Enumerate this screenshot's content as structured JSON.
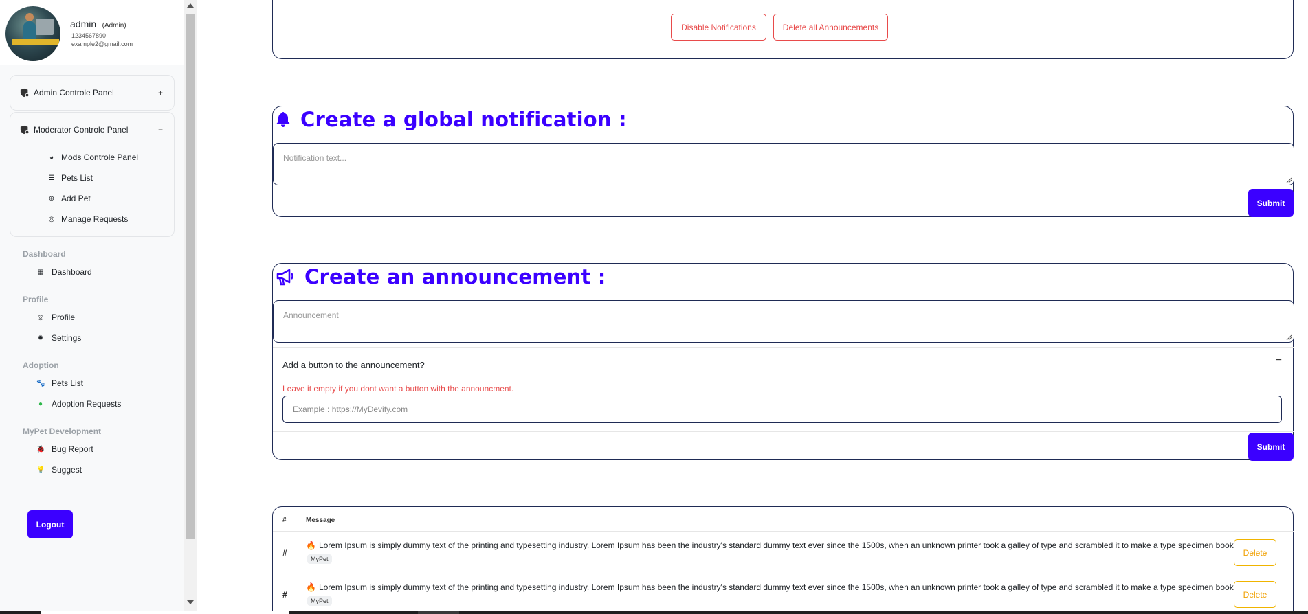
{
  "profile": {
    "name": "admin",
    "role": "(Admin)",
    "phone": "1234567890",
    "email": "example2@gmail.com"
  },
  "sidebar": {
    "admin_panel": {
      "label": "Admin Controle Panel",
      "toggle": "+"
    },
    "moderator_panel": {
      "label": "Moderator Controle Panel",
      "toggle": "−",
      "items": [
        {
          "label": "Mods Controle Panel",
          "icon": "palette-icon"
        },
        {
          "label": "Pets List",
          "icon": "list-icon"
        },
        {
          "label": "Add Pet",
          "icon": "plus-circle-icon"
        },
        {
          "label": "Manage Requests",
          "icon": "user-circle-icon"
        }
      ]
    },
    "sections": [
      {
        "title": "Dashboard",
        "items": [
          {
            "label": "Dashboard",
            "icon": "dashboard-icon"
          }
        ]
      },
      {
        "title": "Profile",
        "items": [
          {
            "label": "Profile",
            "icon": "user-circle-icon"
          },
          {
            "label": "Settings",
            "icon": "gear-icon"
          }
        ]
      },
      {
        "title": "Adoption",
        "items": [
          {
            "label": "Pets List",
            "icon": "paw-icon"
          },
          {
            "label": "Adoption Requests",
            "icon": "check-circle-icon"
          }
        ]
      },
      {
        "title": "MyPet Development",
        "items": [
          {
            "label": "Bug Report",
            "icon": "bug-icon"
          },
          {
            "label": "Suggest",
            "icon": "lightbulb-icon"
          }
        ]
      }
    ],
    "logout_label": "Logout"
  },
  "top_card": {
    "disable_label": "Disable Notifications",
    "delete_all_label": "Delete all Announcements"
  },
  "notification": {
    "title": "Create a global notification :",
    "placeholder": "Notification text...",
    "submit_label": "Submit"
  },
  "announcement": {
    "title": "Create an announcement :",
    "placeholder": "Announcement",
    "button_question": "Add a button to the announcement?",
    "toggle": "−",
    "warning": "Leave it empty if you dont want a button with the announcment.",
    "url_placeholder": "Example : https://MyDevify.com",
    "submit_label": "Submit"
  },
  "table": {
    "col_hash": "#",
    "col_message": "Message",
    "rows": [
      {
        "hash": "#",
        "message": "Lorem Ipsum is simply dummy text of the printing and typesetting industry. Lorem Ipsum has been the industry's standard dummy text ever since the 1500s, when an unknown printer took a galley of type and scrambled it to make a type specimen book.",
        "tag": "MyPet",
        "delete_label": "Delete"
      },
      {
        "hash": "#",
        "message": "Lorem Ipsum is simply dummy text of the printing and typesetting industry. Lorem Ipsum has been the industry's standard dummy text ever since the 1500s, when an unknown printer took a galley of type and scrambled it to make a type specimen book.",
        "tag": "MyPet",
        "delete_label": "Delete"
      }
    ]
  },
  "colors": {
    "accent": "#3b00ff",
    "danger": "#e84b4b",
    "warning": "#f0a000",
    "border": "#1f2b55"
  }
}
